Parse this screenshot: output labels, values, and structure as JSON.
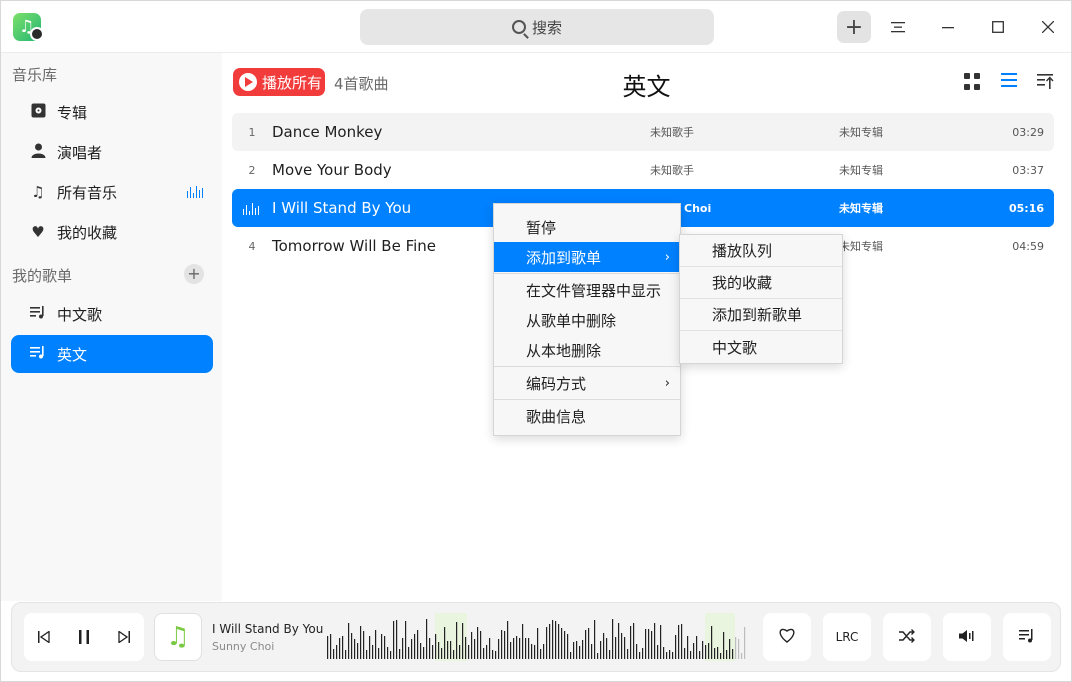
{
  "titlebar": {
    "search_placeholder": "搜索"
  },
  "sidebar": {
    "library_title": "音乐库",
    "library_items": [
      {
        "label": "专辑",
        "icon": "album-icon"
      },
      {
        "label": "演唱者",
        "icon": "singer-icon"
      },
      {
        "label": "所有音乐",
        "icon": "music-note-icon"
      },
      {
        "label": "我的收藏",
        "icon": "heart-icon"
      }
    ],
    "playlists_title": "我的歌单",
    "playlists": [
      {
        "label": "中文歌",
        "icon": "playlist-icon"
      },
      {
        "label": "英文",
        "icon": "playlist-icon",
        "active": true
      }
    ]
  },
  "header": {
    "play_all_label": "播放所有",
    "song_count": "4首歌曲",
    "title": "英文"
  },
  "songs": [
    {
      "index": "1",
      "title": "Dance Monkey",
      "artist": "未知歌手",
      "album": "未知专辑",
      "duration": "03:29"
    },
    {
      "index": "2",
      "title": "Move Your Body",
      "artist": "未知歌手",
      "album": "未知专辑",
      "duration": "03:37"
    },
    {
      "index": "",
      "title": "I Will Stand By You",
      "artist": "Choi",
      "album": "未知专辑",
      "duration": "05:16",
      "playing": true
    },
    {
      "index": "4",
      "title": "Tomorrow Will Be Fine",
      "artist": "",
      "album": "未知专辑",
      "duration": "04:59"
    }
  ],
  "context_menu": {
    "items": [
      "暂停",
      "添加到歌单",
      "在文件管理器中显示",
      "从歌单中删除",
      "从本地删除",
      "编码方式",
      "歌曲信息"
    ],
    "highlighted": "添加到歌单"
  },
  "submenu": {
    "items": [
      "播放队列",
      "我的收藏",
      "添加到新歌单",
      "中文歌"
    ]
  },
  "player": {
    "title": "I Will Stand By You",
    "artist": "Sunny Choi",
    "lrc_label": "LRC"
  },
  "colors": {
    "accent": "#0081ff",
    "play_all": "#f23c3c",
    "sidebar_bg": "#f8f8f8"
  }
}
